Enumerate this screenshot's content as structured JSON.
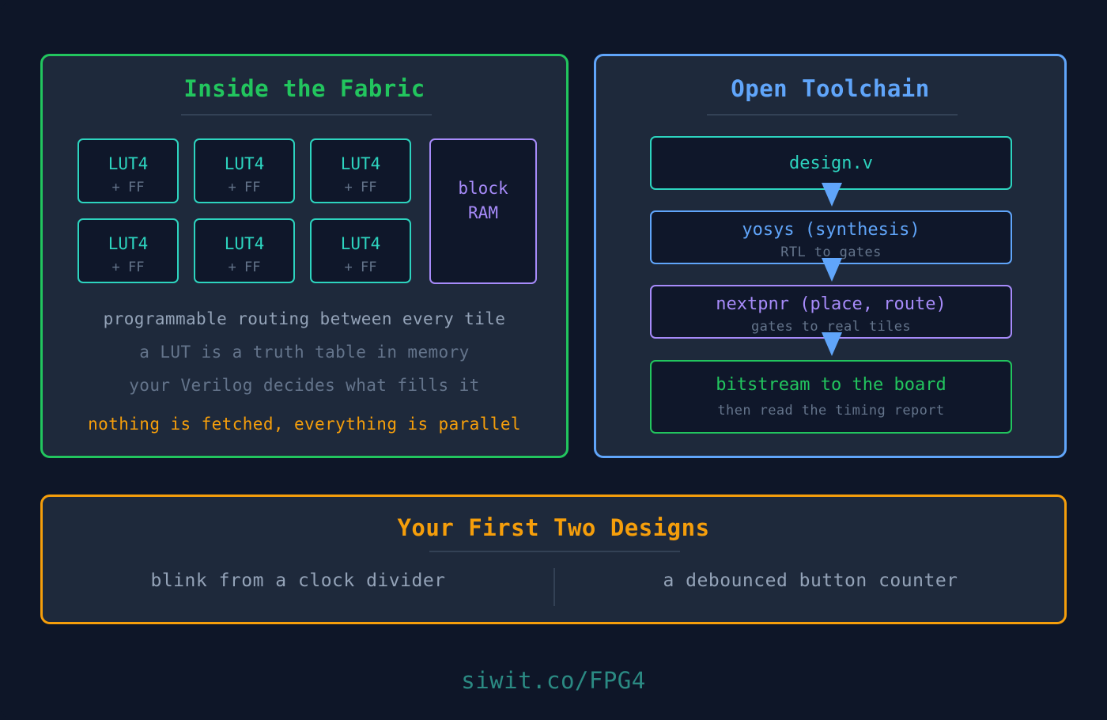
{
  "colors": {
    "background": "#0e1628",
    "panel": "#1e293b",
    "green": "#22c55e",
    "blue": "#60a5fa",
    "teal": "#2dd4bf",
    "purple": "#a78bfa",
    "orange": "#f59e0b",
    "muted": "#64748b",
    "text": "#94a3b8",
    "link": "#2b8a83"
  },
  "fabric": {
    "title": "Inside the Fabric",
    "luts": [
      {
        "name": "LUT4",
        "sub": "+ FF"
      },
      {
        "name": "LUT4",
        "sub": "+ FF"
      },
      {
        "name": "LUT4",
        "sub": "+ FF"
      },
      {
        "name": "LUT4",
        "sub": "+ FF"
      },
      {
        "name": "LUT4",
        "sub": "+ FF"
      },
      {
        "name": "LUT4",
        "sub": "+ FF"
      }
    ],
    "bram": {
      "line1": "block",
      "line2": "RAM"
    },
    "lines": [
      "programmable routing between every tile",
      "a LUT is a truth table in memory",
      "your Verilog decides what fills it",
      "nothing is fetched, everything is parallel"
    ]
  },
  "toolchain": {
    "title": "Open Toolchain",
    "steps": [
      {
        "label": "design.v",
        "sub": ""
      },
      {
        "label": "yosys (synthesis)",
        "sub": "RTL to gates"
      },
      {
        "label": "nextpnr (place, route)",
        "sub": "gates to real tiles"
      },
      {
        "label": "bitstream to the board",
        "sub": "then read the timing report"
      }
    ],
    "arrow_icon": "down-arrow-icon"
  },
  "designs": {
    "title": "Your First Two Designs",
    "items": [
      "blink from a clock divider",
      "a debounced button counter"
    ]
  },
  "footer": {
    "link": "siwit.co/FPG4"
  }
}
